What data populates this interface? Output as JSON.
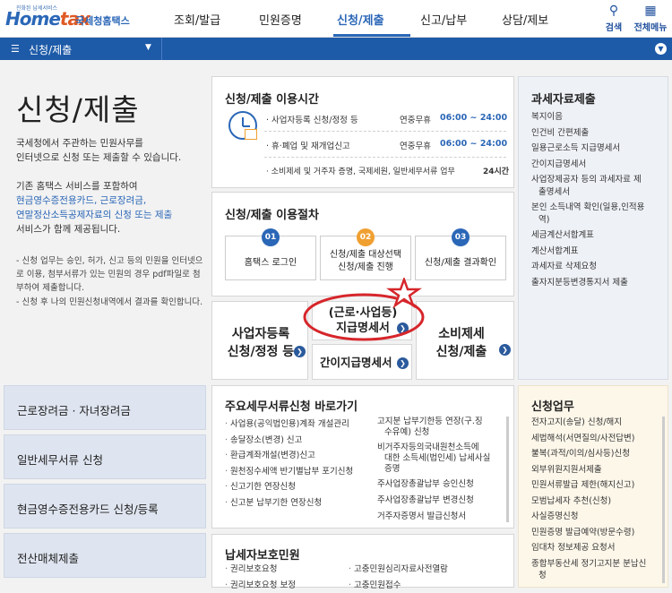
{
  "header": {
    "logo_tagline": "진화된 납세서비스",
    "logo_word_a": "Home",
    "logo_word_b": "tax",
    "logo_agency": "국세청홈택스",
    "nav": [
      "조회/발급",
      "민원증명",
      "신청/제출",
      "신고/납부",
      "상담/제보"
    ],
    "active_nav": "신청/제출",
    "search_label": "검색",
    "menu_label": "전체메뉴"
  },
  "bar": {
    "title": "신청/제출"
  },
  "intro": {
    "title": "신청/제출",
    "p1": [
      "국세청에서 주관하는 민원사무를",
      "인터넷으로 신청 또는 제출할 수 있습니다."
    ],
    "p2a": "기존 홈택스 서비스를 포함하여",
    "p2b": [
      "현금영수증전용카드, 근로장려금,",
      "연말정산소득공제자료의 신청 또는 제출"
    ],
    "p2c": "서비스가 함께 제공됩니다.",
    "n1": [
      "- 신청 업무는 승인, 허가, 신고 등의 민원을 인터넷으",
      "로 이용, 첨부서류가 있는 민원의 경우 pdf파일로 첨",
      "부하여 제출합니다."
    ],
    "n2": "- 신청 후 나의 민원신청내역에서 결과를 확인합니다."
  },
  "hours": {
    "title": "신청/제출 이용시간",
    "rows": [
      {
        "label": "· 사업자등록 신청/정정 등",
        "prefix": "연중무휴",
        "time": "06:00 ~ 24:00"
      },
      {
        "label": "· 휴·폐업 및 재개업신고",
        "prefix": "연중무휴",
        "time": "06:00 ~ 24:00"
      },
      {
        "label": "· 소비제세 및 거주자 증명, 국제세원, 일반세무서류 업무",
        "prefix": "",
        "time": "24시간"
      }
    ]
  },
  "procedure": {
    "title": "신청/제출 이용절차",
    "steps": [
      {
        "num": "01",
        "label": [
          "홈택스 로그인"
        ],
        "color": "#2b67b7"
      },
      {
        "num": "02",
        "label": [
          "신청/제출 대상선택",
          "신청/제출 진행"
        ],
        "color": "#f0a030"
      },
      {
        "num": "03",
        "label": [
          "신청/제출 결과확인"
        ],
        "color": "#2b67b7"
      }
    ]
  },
  "tiles": {
    "biz": [
      "사업자등록",
      "신청/정정 등"
    ],
    "pay": [
      "(근로·사업등)",
      "지급명세서"
    ],
    "simple": "간이지급명세서",
    "consume": [
      "소비제세",
      "신청/제출"
    ]
  },
  "left_buttons": [
    "근로장려금 · 자녀장려금",
    "일반세무서류 신청",
    "현금영수증전용카드 신청/등록",
    "전산매체제출"
  ],
  "docs": {
    "title": "주요세무서류신청 바로가기",
    "left": [
      "사업용(공익법인용)계좌 개설관리",
      "송달장소(변경) 신고",
      "환급계좌개설(변경)신고",
      "원천징수세액 반기별납부 포기신청",
      "신고기한 연장신청",
      "신고분 납부기한 연장신청"
    ],
    "right": [
      [
        "고지분 납부기한등 연장(구.징",
        "수유예) 신청"
      ],
      [
        "비거주자등의국내원천소득에",
        "대한 소득세(법인세) 납세사실",
        "증명"
      ],
      [
        "주사업장총괄납부 승인신청"
      ],
      [
        "주사업장총괄납부 변경신청"
      ],
      [
        "거주자증명서 발급신청서"
      ]
    ]
  },
  "protect": {
    "title": "납세자보호민원",
    "left": [
      "권리보호요청",
      "권리보호요청 보정"
    ],
    "right": [
      "고충민원심리자료사전열람",
      "고충민원접수"
    ]
  },
  "tax_docs": {
    "title": "과세자료제출",
    "items": [
      [
        "복지이음"
      ],
      [
        "인건비 간편제출"
      ],
      [
        "일용근로소득 지급명세서"
      ],
      [
        "간이지급명세서"
      ],
      [
        "사업장제공자 등의 과세자료 제",
        "출명세서"
      ],
      [
        "본인 소득내역 확인(일용,인적용",
        "역)"
      ],
      [
        "세금계산서합계표"
      ],
      [
        "계산서합계표"
      ],
      [
        "과세자료 삭제요청"
      ],
      [
        "출자지분등변경통지서 제출"
      ]
    ]
  },
  "apply": {
    "title": "신청업무",
    "items": [
      [
        "전자고지(송달) 신청/해지"
      ],
      [
        "세법해석(서면질의/사전답변)"
      ],
      [
        "불복(과적/이의/심사등)신청"
      ],
      [
        "외부위원지원서제출"
      ],
      [
        "민원서류발급 제한(해지신고)"
      ],
      [
        "모범납세자 추천(신청)"
      ],
      [
        "사실증명신청"
      ],
      [
        "민원증명 발급예약(방문수령)"
      ],
      [
        "임대차 정보제공 요청서"
      ],
      [
        "종합부동산세 정기고지분 분납신",
        "청"
      ]
    ]
  },
  "colors": {
    "brand": "#2b67b7",
    "bar": "#1d5aa8",
    "step_orange": "#f0a030",
    "annotation_red": "#d6262b"
  }
}
